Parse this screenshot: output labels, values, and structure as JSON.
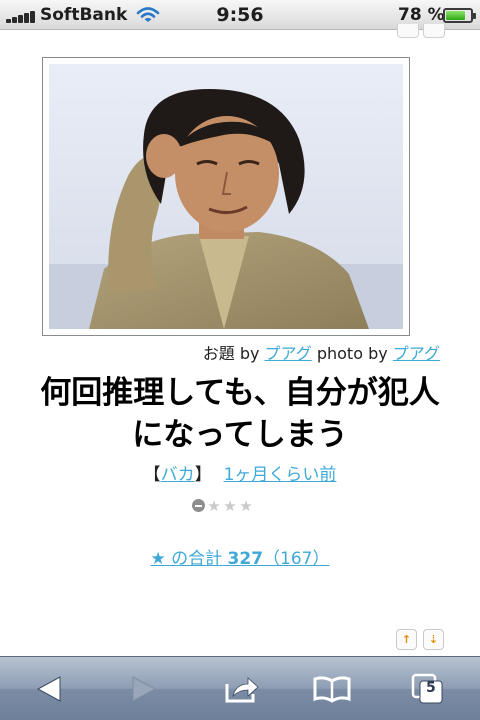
{
  "status_bar": {
    "carrier": "SoftBank",
    "time": "9:56",
    "battery_percent": "78 %",
    "battery_level": 0.78
  },
  "photo": {
    "description_icon": "photo-of-man-scratching-head"
  },
  "credit": {
    "prefix": "お題 by",
    "odai_author": "プアグ",
    "photo_prefix": "photo by",
    "photo_author": "プアグ"
  },
  "bokete": {
    "title_line1": "何回推理しても、自分が犯人",
    "title_line2": "になってしまう",
    "category_open": "【",
    "category": "バカ",
    "category_close": "】",
    "posted_ago": "1ヶ月くらい前"
  },
  "rating": {
    "filled": 0,
    "max": 3
  },
  "total": {
    "label": "★ の合計",
    "count": "327",
    "votes": "（167）"
  },
  "toolbar": {
    "tab_count": "5"
  },
  "colors": {
    "link": "#3fa9d6",
    "toolbar_top": "#b8c3d2",
    "toolbar_bottom": "#6f809b"
  }
}
